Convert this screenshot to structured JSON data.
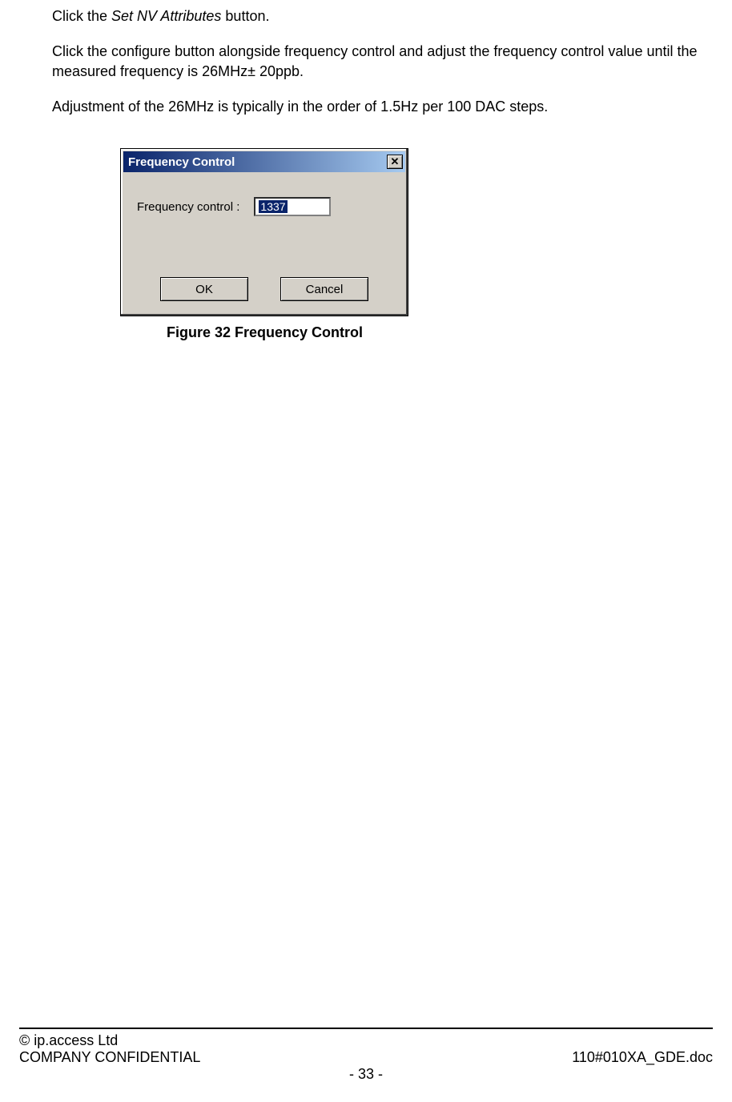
{
  "para1": {
    "pre": "Click the ",
    "em": "Set NV Attributes",
    "post": " button."
  },
  "para2": "Click the configure button alongside frequency control and adjust the frequency control value until the measured frequency is 26MHz± 20ppb.",
  "para3": "Adjustment of the 26MHz is typically in the order of 1.5Hz per 100 DAC steps.",
  "dialog": {
    "title": "Frequency Control",
    "close_glyph": "✕",
    "field_label": "Frequency control :",
    "field_value": "1337",
    "ok_label": "OK",
    "cancel_label": "Cancel"
  },
  "caption": "Figure 32 Frequency Control",
  "footer": {
    "copyright": "© ip.access Ltd",
    "confidential": "COMPANY CONFIDENTIAL",
    "doc": "110#010XA_GDE.doc",
    "page": "- 33 -"
  }
}
